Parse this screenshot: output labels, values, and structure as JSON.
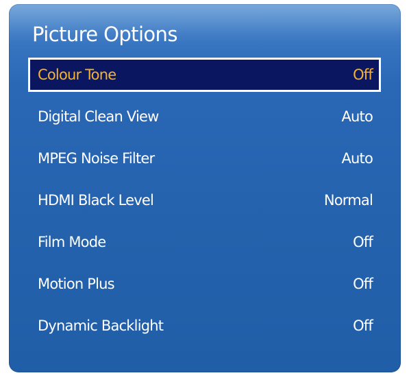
{
  "menu": {
    "title": "Picture Options",
    "items": [
      {
        "label": "Colour Tone",
        "value": "Off",
        "selected": true
      },
      {
        "label": "Digital Clean View",
        "value": "Auto"
      },
      {
        "label": "MPEG Noise Filter",
        "value": "Auto"
      },
      {
        "label": "HDMI Black Level",
        "value": "Normal"
      },
      {
        "label": "Film Mode",
        "value": "Off"
      },
      {
        "label": "Motion Plus",
        "value": "Off"
      },
      {
        "label": "Dynamic Backlight",
        "value": "Off"
      }
    ]
  },
  "colors": {
    "panel_blue": "#2462ad",
    "selected_background": "#0a1760",
    "selected_text": "#f7b22e",
    "text": "#ffffff"
  }
}
